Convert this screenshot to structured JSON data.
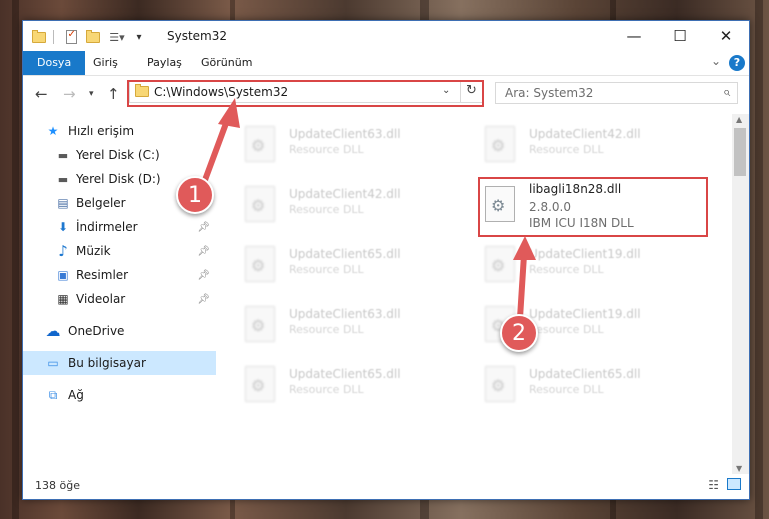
{
  "window": {
    "title": "System32",
    "controls": {
      "minimize": "—",
      "maximize": "☐",
      "close": "✕"
    }
  },
  "ribbon": {
    "tabs": [
      {
        "label": "Dosya",
        "active": true
      },
      {
        "label": "Giriş"
      },
      {
        "label": "Paylaş"
      },
      {
        "label": "Görünüm"
      }
    ],
    "collapse_icon": "chevron-down-icon",
    "help_icon": "help-icon",
    "help_label": "?"
  },
  "address": {
    "path": "C:\\Windows\\System32",
    "search_placeholder": "Ara: System32"
  },
  "sidebar": {
    "items": [
      {
        "label": "Hızlı erişim",
        "icon": "star-icon",
        "glyph": "★",
        "color": "#1e90ff"
      },
      {
        "label": "Yerel Disk (C:)",
        "icon": "drive-icon",
        "glyph": "▬",
        "color": "#5a5a5a"
      },
      {
        "label": "Yerel Disk (D:)",
        "icon": "drive-icon",
        "glyph": "▬",
        "color": "#5a5a5a"
      },
      {
        "label": "Belgeler",
        "icon": "documents-icon",
        "glyph": "▤",
        "color": "#4a6fa5"
      },
      {
        "label": "İndirmeler",
        "icon": "download-icon",
        "glyph": "⬇",
        "color": "#1e78d0",
        "pinned": true
      },
      {
        "label": "Müzik",
        "icon": "music-icon",
        "glyph": "♪",
        "color": "#1e78d0",
        "pinned": true
      },
      {
        "label": "Resimler",
        "icon": "pictures-icon",
        "glyph": "▣",
        "color": "#3a7bd5",
        "pinned": true
      },
      {
        "label": "Videolar",
        "icon": "videos-icon",
        "glyph": "▦",
        "color": "#333333",
        "pinned": true
      },
      {
        "label": "OneDrive",
        "icon": "cloud-icon",
        "glyph": "☁",
        "color": "#1166cc"
      },
      {
        "label": "Bu bilgisayar",
        "icon": "computer-icon",
        "glyph": "▭",
        "color": "#3a8ee6",
        "selected": true
      },
      {
        "label": "Ağ",
        "icon": "network-icon",
        "glyph": "⧉",
        "color": "#3a8ee6"
      }
    ]
  },
  "files": [
    {
      "name": "UpdateClient63.dll",
      "type": "Resource DLL"
    },
    {
      "name": "UpdateClient42.dll",
      "type": "Resource DLL"
    },
    {
      "name": "UpdateClient42.dll",
      "type": "Resource DLL"
    },
    {
      "name": "libagli18n28.dll",
      "version": "2.8.0.0",
      "type": "IBM ICU I18N DLL",
      "highlighted": true
    },
    {
      "name": "UpdateClient65.dll",
      "type": "Resource DLL"
    },
    {
      "name": "UpdateClient19.dll",
      "type": "Resource DLL"
    },
    {
      "name": "UpdateClient63.dll",
      "type": "Resource DLL"
    },
    {
      "name": "UpdateClient19.dll",
      "type": "Resource DLL"
    },
    {
      "name": "UpdateClient65.dll",
      "type": "Resource DLL"
    },
    {
      "name": "UpdateClient65.dll",
      "type": "Resource DLL"
    }
  ],
  "status": {
    "count": "138 öğe"
  },
  "annotations": {
    "step1": "1",
    "step2": "2"
  },
  "colors": {
    "accent": "#1979ca",
    "highlight": "#d94646",
    "badge": "#e05a5a"
  }
}
